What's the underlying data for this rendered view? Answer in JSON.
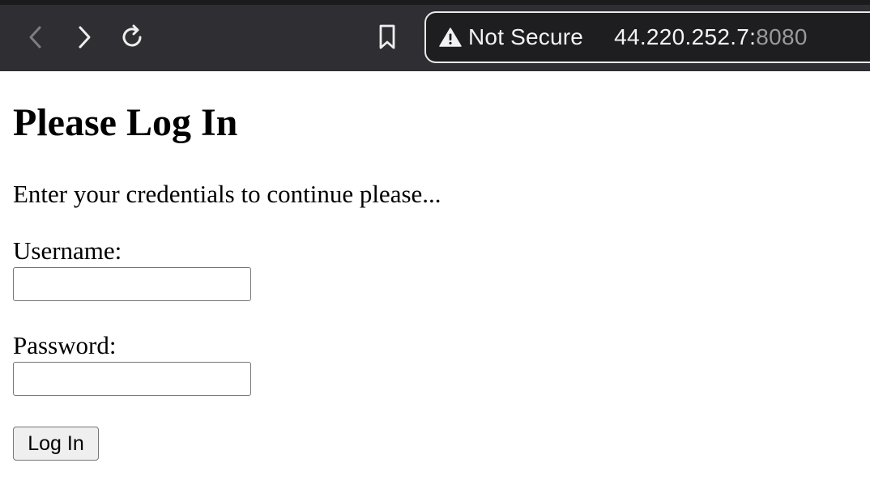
{
  "browser": {
    "security_label": "Not Secure",
    "url_host": "44.220.252.7:",
    "url_port": "8080",
    "icons": {
      "back": "chevron-left-icon",
      "forward": "chevron-right-icon",
      "reload": "reload-icon",
      "bookmark": "bookmark-icon",
      "warning": "warning-triangle-icon"
    },
    "colors": {
      "toolbar": "#2f2f33",
      "urlbar_bg": "#1e1e20",
      "urlbar_border": "#e9e9ea",
      "port_text": "#9a9a9e"
    }
  },
  "page": {
    "title": "Please Log In",
    "intro": "Enter your credentials to continue please...",
    "username_label": "Username:",
    "username_value": "",
    "password_label": "Password:",
    "password_value": "",
    "submit_label": "Log In"
  }
}
